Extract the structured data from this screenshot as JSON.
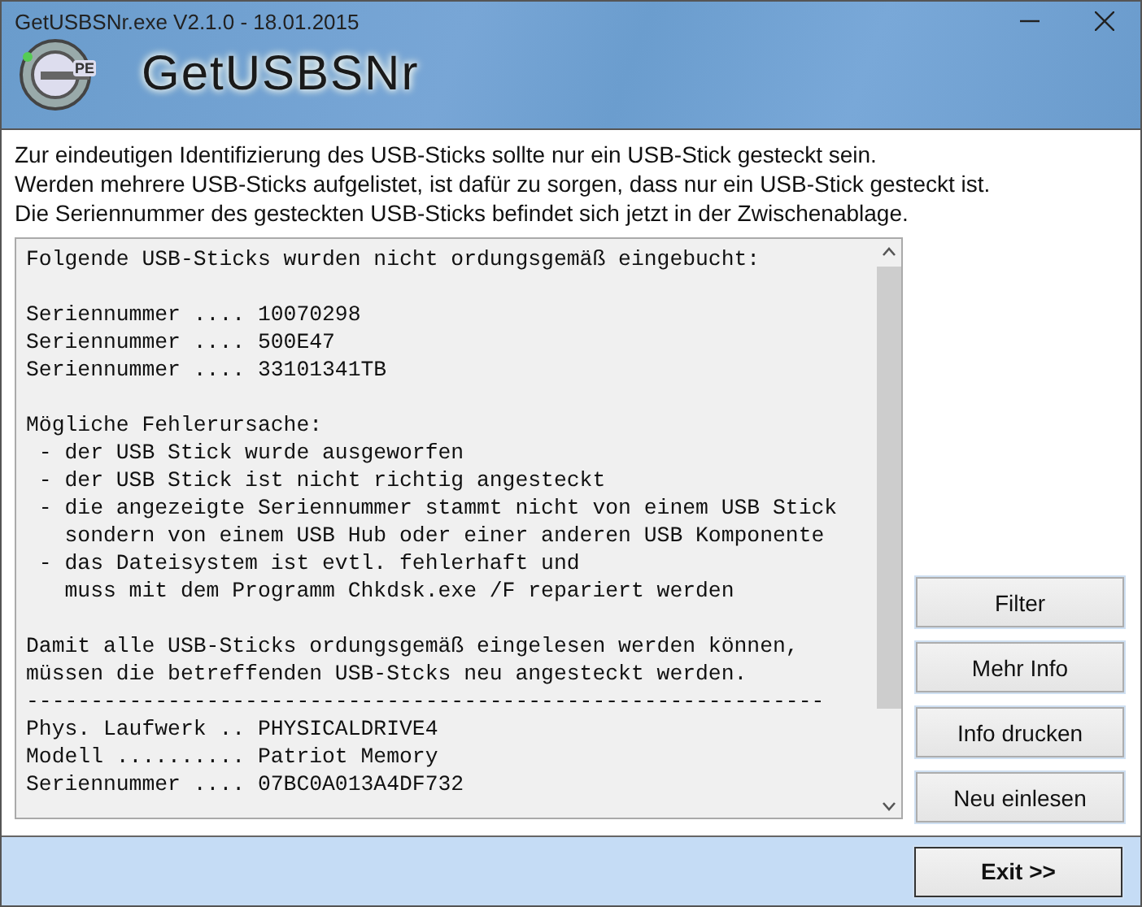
{
  "window": {
    "title": "GetUSBSNr.exe V2.1.0 - 18.01.2015"
  },
  "banner": {
    "logo_mark": "PE",
    "app_name": "GetUSBSNr"
  },
  "intro": [
    "Zur eindeutigen Identifizierung des USB-Sticks sollte nur ein USB-Stick gesteckt sein.",
    "Werden mehrere USB-Sticks aufgelistet, ist dafür zu sorgen, dass nur ein USB-Stick gesteckt ist.",
    "Die Seriennummer des gesteckten USB-Sticks befindet sich jetzt in der Zwischenablage."
  ],
  "output": {
    "paragraphs": [
      [
        "Folgende USB-Sticks wurden nicht ordungsgemäß eingebucht:"
      ],
      [
        "Seriennummer .... 10070298",
        "Seriennummer .... 500E47",
        "Seriennummer .... 33101341TB"
      ],
      [
        "Mögliche Fehlerursache:",
        " - der USB Stick wurde ausgeworfen",
        " - der USB Stick ist nicht richtig angesteckt",
        " - die angezeigte Seriennummer stammt nicht von einem USB Stick",
        "   sondern von einem USB Hub oder einer anderen USB Komponente",
        " - das Dateisystem ist evtl. fehlerhaft und",
        "   muss mit dem Programm Chkdsk.exe /F repariert werden"
      ],
      [
        "Damit alle USB-Sticks ordungsgemäß eingelesen werden können,",
        "müssen die betreffenden USB-Stcks neu angesteckt werden.",
        "--------------------------------------------------------------",
        "Phys. Laufwerk .. PHYSICALDRIVE4",
        "Modell .......... Patriot Memory",
        "Seriennummer .... 07BC0A013A4DF732"
      ]
    ]
  },
  "side_buttons": [
    "Filter",
    "Mehr Info",
    "Info drucken",
    "Neu einlesen"
  ],
  "footer": {
    "exit_button": "Exit >>"
  }
}
